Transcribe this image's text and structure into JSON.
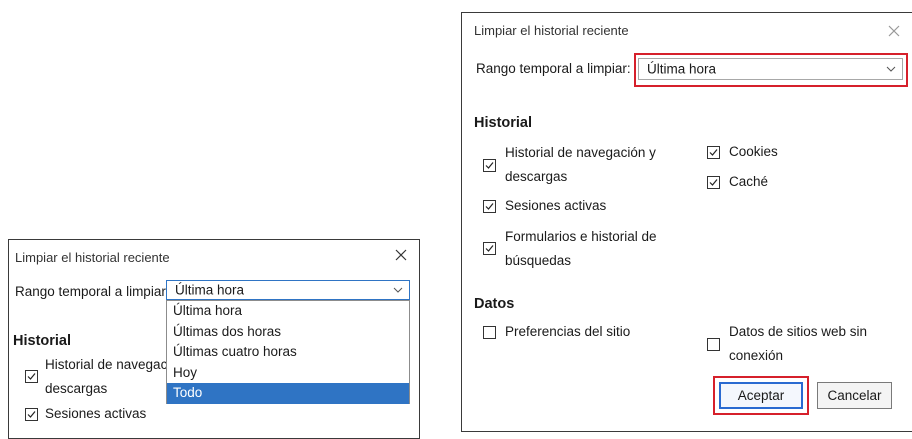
{
  "small_dialog": {
    "title": "Limpiar el historial reciente",
    "range_label": "Rango temporal a limpiar:",
    "range_value": "Última hora",
    "dropdown_options": [
      "Última hora",
      "Últimas dos horas",
      "Últimas cuatro horas",
      "Hoy",
      "Todo"
    ],
    "dropdown_highlighted": "Todo",
    "history_heading": "Historial",
    "items": [
      {
        "label_line1": "Historial de navegación y",
        "label_line2": "descargas",
        "checked": true
      },
      {
        "label_line1": "Sesiones activas",
        "checked": true
      }
    ]
  },
  "large_dialog": {
    "title": "Limpiar el historial reciente",
    "range_label": "Rango temporal a limpiar:",
    "range_value": "Última hora",
    "history_heading": "Historial",
    "history_items": [
      {
        "label_line1": "Historial de navegación y",
        "label_line2": "descargas",
        "checked": true
      },
      {
        "label_line1": "Cookies",
        "checked": true
      },
      {
        "label_line1": "Caché",
        "checked": true
      },
      {
        "label_line1": "Sesiones activas",
        "checked": true
      },
      {
        "label_line1": "Formularios e historial de",
        "label_line2": "búsquedas",
        "checked": true
      }
    ],
    "data_heading": "Datos",
    "data_items": [
      {
        "label_line1": "Preferencias del sitio",
        "checked": false
      },
      {
        "label_line1": "Datos de sitios web sin",
        "label_line2": "conexión",
        "checked": false
      }
    ],
    "accept_label": "Aceptar",
    "cancel_label": "Cancelar"
  },
  "colors": {
    "highlight_border": "#d6202b",
    "dropdown_selected": "#2f74c4",
    "primary_button_border": "#2a6ad1"
  },
  "icons": [
    "close-icon",
    "chevron-down-icon",
    "checkmark-icon"
  ]
}
